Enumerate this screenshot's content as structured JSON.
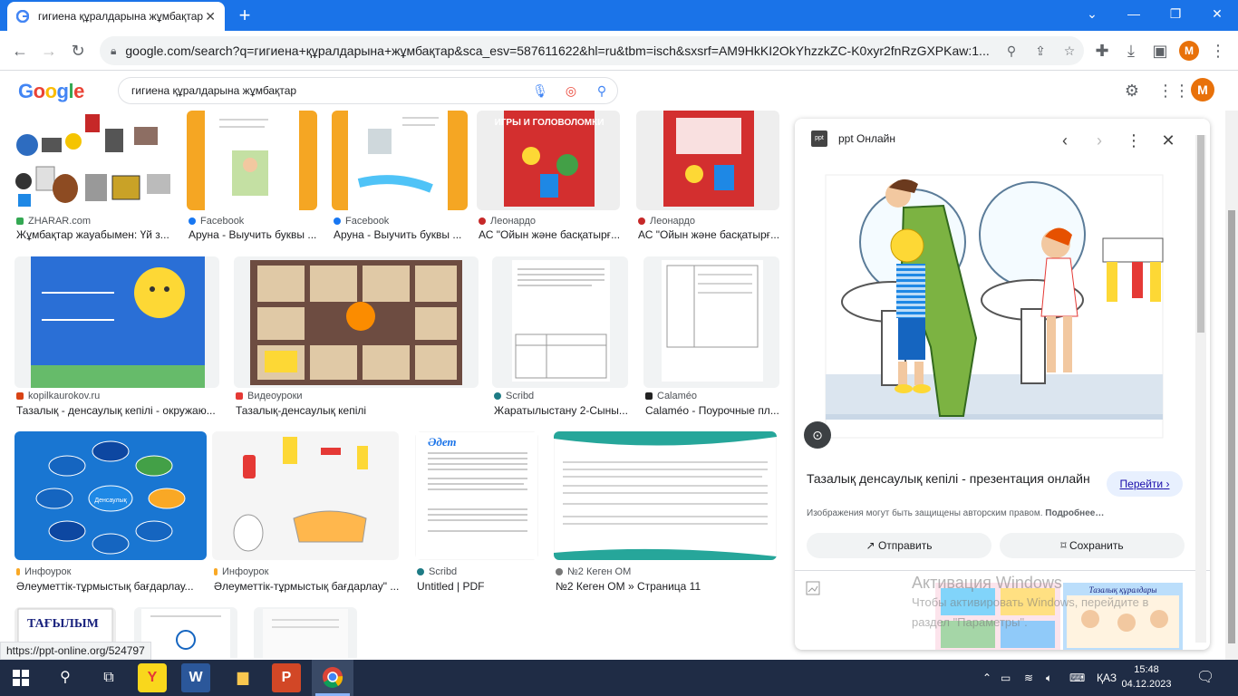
{
  "browser": {
    "tab_title": "гигиена құралдарына жұмбақтар",
    "tab_close": "✕",
    "new_tab": "+",
    "url": "google.com/search?q=гигиена+құралдарына+жұмбақтар&sca_esv=587611622&hl=ru&tbm=isch&sxsrf=AM9HkKI2OkYhzzkZC-K0xyr2fnRzGXPKaw:1...",
    "profile_initial": "M"
  },
  "google": {
    "logo": "Google",
    "query": "гигиена құралдарына жұмбақтар",
    "profile_initial": "M"
  },
  "results": [
    {
      "source": "ZHARAR.com",
      "title": "Жұмбақтар жауабымен: Үй з...",
      "color": "#34a853"
    },
    {
      "source": "Facebook",
      "title": "Аруна - Выучить буквы ...",
      "color": "#1877f2"
    },
    {
      "source": "Facebook",
      "title": "Аруна - Выучить буквы ...",
      "color": "#1877f2"
    },
    {
      "source": "Леонардо",
      "title": "АС \"Ойын және басқатырғ...",
      "color": "#c62828"
    },
    {
      "source": "Леонардо",
      "title": "АС \"Ойын және басқатырғ...",
      "color": "#c62828"
    },
    {
      "source": "kopilkaurokov.ru",
      "title": "Тазалық - денсаулық кепілі - окружаю...",
      "color": "#d84315"
    },
    {
      "source": "Видеоуроки",
      "title": "Тазалық-денсаулық кепілі",
      "color": "#e53935"
    },
    {
      "source": "Scribd",
      "title": "Жаратылыстану 2-Сыны...",
      "color": "#1e7b85"
    },
    {
      "source": "Calaméo",
      "title": "Calaméo - Поурочные пл...",
      "color": "#222222"
    },
    {
      "source": "Инфоурок",
      "title": "Әлеуметтік-тұрмыстық бағдарлау...",
      "color": "#f9a825"
    },
    {
      "source": "Инфоурок",
      "title": "Әлеуметтік-тұрмыстық бағдарлау\" ...",
      "color": "#f9a825"
    },
    {
      "source": "Scribd",
      "title": "Untitled | PDF",
      "color": "#1e7b85"
    },
    {
      "source": "№2 Кеген ОМ",
      "title": "№2 Кеген ОМ » Страница 11",
      "color": "#777777"
    }
  ],
  "thumb_texts": {
    "games_title": "ИГРЫ И ГОЛОВОЛОМКИ",
    "tagylym": "ТАҒЫЛЫМ",
    "center_label": "Денсаулық",
    "adet": "Әдет"
  },
  "panel": {
    "site": "ppt Онлайн",
    "site_badge": "ppt",
    "title": "Тазалық денсаулық кепілі - презентация онлайн",
    "visit": "Перейти",
    "copyright_prefix": "Изображения могут быть защищены авторским правом.",
    "copyright_more": "Подробнее…",
    "share": "Отправить",
    "save": "Сохранить",
    "related_label": "Тазалық құралдары"
  },
  "watermark": {
    "line1": "Активация Windows",
    "line2": "Чтобы активировать Windows, перейдите в",
    "line3": "раздел \"Параметры\"."
  },
  "status_url": "https://ppt-online.org/524797",
  "taskbar": {
    "lang": "ҚАЗ",
    "time": "15:48",
    "date": "04.12.2023"
  }
}
